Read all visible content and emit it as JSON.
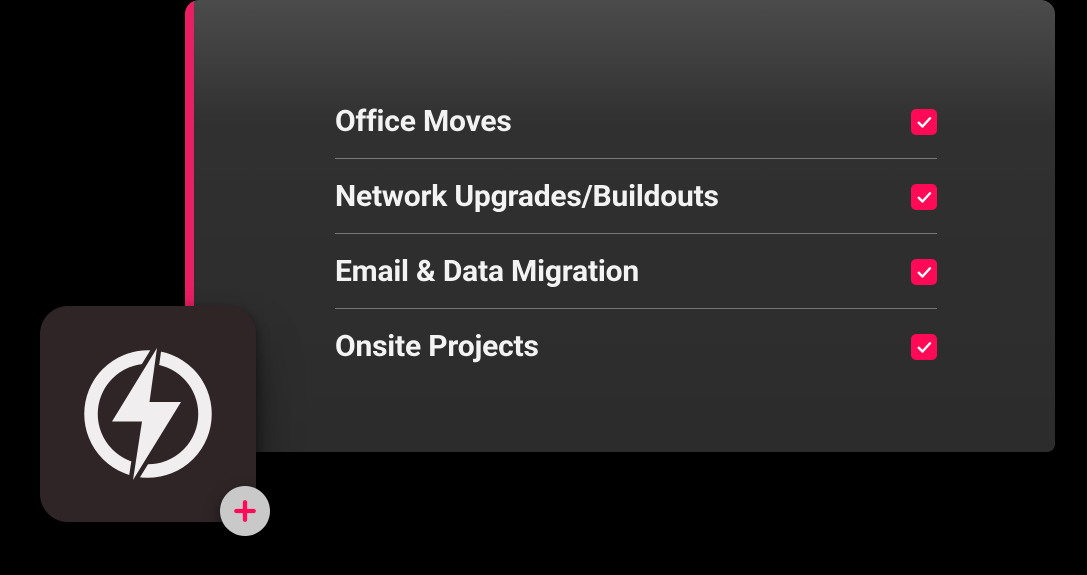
{
  "services": {
    "items": [
      {
        "label": "Office Moves",
        "checked": true
      },
      {
        "label": "Network Upgrades/Buildouts",
        "checked": true
      },
      {
        "label": "Email & Data Migration",
        "checked": true
      },
      {
        "label": "Onsite Projects",
        "checked": true
      }
    ]
  },
  "colors": {
    "accent": "#e91e63",
    "checkbox": "#ff0a56",
    "panel_bg_top": "#4b4b4b",
    "panel_bg_bottom": "#2c2c2c",
    "badge_bg": "#2f2527",
    "plus_bg": "#c9c9c9",
    "plus_fg": "#ff0a56"
  },
  "icons": {
    "badge": "lightning-bolt-circle",
    "plus": "plus-icon",
    "check": "checkmark-icon"
  }
}
